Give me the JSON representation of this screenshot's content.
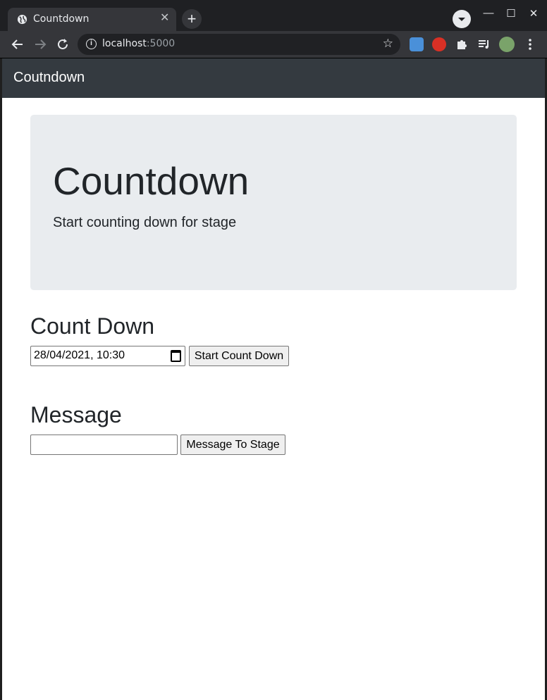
{
  "browser": {
    "tab_title": "Countdown",
    "url_host": "localhost",
    "url_port": ":5000",
    "new_tab": "+",
    "close_tab": "✕",
    "minimize": "—",
    "maximize": "☐",
    "close_window": "✕"
  },
  "navbar": {
    "brand": "Coutndown"
  },
  "jumbotron": {
    "title": "Countdown",
    "lead": "Start counting down for stage"
  },
  "countdown": {
    "heading": "Count Down",
    "datetime_value": "28/04/2021, 10:30",
    "start_button": "Start Count Down"
  },
  "message": {
    "heading": "Message",
    "input_value": "",
    "send_button": "Message To Stage"
  },
  "colors": {
    "navbar_bg": "#343a40",
    "jumbotron_bg": "#e9ecef",
    "text": "#212529"
  }
}
